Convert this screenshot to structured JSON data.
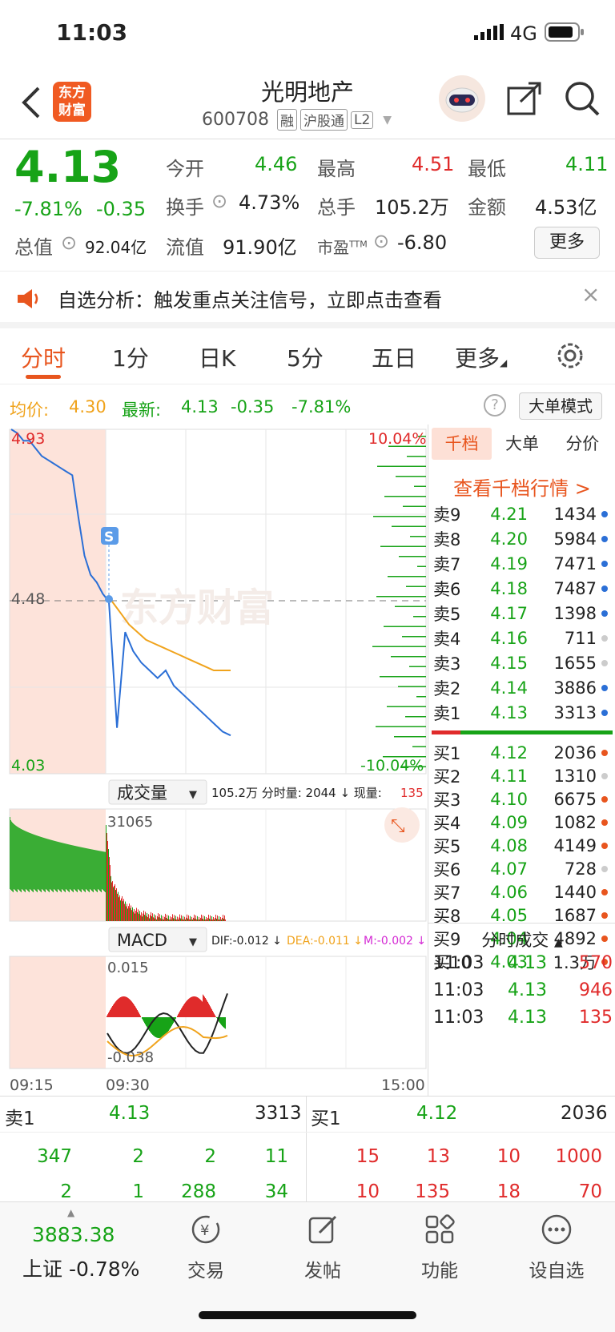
{
  "status": {
    "time": "11:03",
    "network": "4G"
  },
  "header": {
    "back_icon": "chevron-left-icon",
    "logo_text": [
      "东方",
      "财富"
    ],
    "stock_name": "光明地产",
    "stock_code": "600708",
    "tags": [
      "融",
      "沪股通",
      "L2"
    ]
  },
  "quote": {
    "price": "4.13",
    "change_pct": "-7.81%",
    "change": "-0.35",
    "open_label": "今开",
    "open": "4.46",
    "high_label": "最高",
    "high": "4.51",
    "low_label": "最低",
    "low": "4.11",
    "turnover_label": "换手",
    "turnover": "4.73%",
    "volume_label": "总手",
    "volume": "105.2万",
    "amount_label": "金额",
    "amount": "4.53亿",
    "total_value_label": "总值",
    "total_value": "92.04亿",
    "float_value_label": "流值",
    "float_value": "91.90亿",
    "pe_label": "市盈",
    "pe_sup": "TTM",
    "pe": "-6.80",
    "more_label": "更多"
  },
  "banner": {
    "text": "自选分析：触发重点关注信号，立即点击查看"
  },
  "tabs": [
    "分时",
    "1分",
    "日K",
    "5分",
    "五日",
    "更多"
  ],
  "avgline": {
    "avg_label": "均价:",
    "avg": "4.30",
    "latest_label": "最新:",
    "latest": "4.13",
    "change": "-0.35",
    "pct": "-7.81%",
    "mode_label": "大单模式"
  },
  "chart": {
    "price_high": "4.93",
    "price_mid": "4.48",
    "price_low": "4.03",
    "pct_high": "10.04%",
    "pct_low": "-10.04%",
    "signal_badge": "S",
    "watermark": "东方财富",
    "vol_selector": "成交量",
    "vol_info": "105.2万 分时量: 2044 ↓ 现量:",
    "vol_now": "135",
    "vol_max": "31065",
    "macd_selector": "MACD",
    "dif": "DIF:-0.012 ↓",
    "dea": "DEA:-0.011 ↓",
    "m": "M:-0.002 ↓",
    "macd_high": "0.015",
    "macd_low": "-0.038",
    "time_start": "09:15",
    "time_open": "09:30",
    "time_end": "15:00"
  },
  "chart_data": {
    "type": "line",
    "series": [
      {
        "values": [
          4.93,
          4.92,
          4.9,
          4.9,
          4.88,
          4.86,
          4.85,
          4.84,
          4.83,
          4.82,
          4.81,
          4.7,
          4.6,
          4.55,
          4.53,
          4.5,
          4.48,
          4.15,
          4.4,
          4.35,
          4.32,
          4.3,
          4.28,
          4.3,
          4.26,
          4.24,
          4.22,
          4.2,
          4.18,
          4.16,
          4.14,
          4.13
        ]
      },
      {
        "values": [
          4.48,
          4.45,
          4.42,
          4.4,
          4.38,
          4.37,
          4.36,
          4.35,
          4.34,
          4.33,
          4.32,
          4.31,
          4.3,
          4.3,
          4.3
        ]
      }
    ],
    "ylim": [
      4.03,
      4.93
    ]
  },
  "orderbook": {
    "tabs": [
      "千档",
      "大单",
      "分价"
    ],
    "link": "查看千档行情 >",
    "asks": [
      {
        "label": "卖9",
        "price": "4.21",
        "vol": "1434",
        "dot": "#2b6fd6"
      },
      {
        "label": "卖8",
        "price": "4.20",
        "vol": "5984",
        "dot": "#2b6fd6"
      },
      {
        "label": "卖7",
        "price": "4.19",
        "vol": "7471",
        "dot": "#2b6fd6"
      },
      {
        "label": "卖6",
        "price": "4.18",
        "vol": "7487",
        "dot": "#2b6fd6"
      },
      {
        "label": "卖5",
        "price": "4.17",
        "vol": "1398",
        "dot": "#2b6fd6"
      },
      {
        "label": "卖4",
        "price": "4.16",
        "vol": "711",
        "dot": "#cccccc"
      },
      {
        "label": "卖3",
        "price": "4.15",
        "vol": "1655",
        "dot": "#cccccc"
      },
      {
        "label": "卖2",
        "price": "4.14",
        "vol": "3886",
        "dot": "#2b6fd6"
      },
      {
        "label": "卖1",
        "price": "4.13",
        "vol": "3313",
        "dot": "#2b6fd6"
      }
    ],
    "bids": [
      {
        "label": "买1",
        "price": "4.12",
        "vol": "2036",
        "dot": "#e8551e"
      },
      {
        "label": "买2",
        "price": "4.11",
        "vol": "1310",
        "dot": "#cccccc"
      },
      {
        "label": "买3",
        "price": "4.10",
        "vol": "6675",
        "dot": "#e8551e"
      },
      {
        "label": "买4",
        "price": "4.09",
        "vol": "1082",
        "dot": "#e8551e"
      },
      {
        "label": "买5",
        "price": "4.08",
        "vol": "4149",
        "dot": "#e8551e"
      },
      {
        "label": "买6",
        "price": "4.07",
        "vol": "728",
        "dot": "#cccccc"
      },
      {
        "label": "买7",
        "price": "4.06",
        "vol": "1440",
        "dot": "#e8551e"
      },
      {
        "label": "买8",
        "price": "4.05",
        "vol": "1687",
        "dot": "#e8551e"
      },
      {
        "label": "买9",
        "price": "4.04",
        "vol": "4892",
        "dot": "#e8551e"
      },
      {
        "label": "买10",
        "price": "4.03",
        "vol": "1.3万",
        "dot": "#e8551e"
      }
    ],
    "fills_label": "分时成交",
    "fills": [
      {
        "time": "11:03",
        "price": "4.13",
        "vol": "570"
      },
      {
        "time": "11:03",
        "price": "4.13",
        "vol": "946"
      },
      {
        "time": "11:03",
        "price": "4.13",
        "vol": "135"
      }
    ]
  },
  "strip": {
    "sell_label": "卖1",
    "sell_price": "4.13",
    "sell_vol": "3313",
    "buy_label": "买1",
    "buy_price": "4.12",
    "buy_vol": "2036",
    "sell_rows": [
      [
        "347",
        "2",
        "2",
        "11"
      ],
      [
        "2",
        "1",
        "288",
        "34"
      ]
    ],
    "buy_rows": [
      [
        "15",
        "13",
        "10",
        "1000"
      ],
      [
        "10",
        "135",
        "18",
        "70"
      ]
    ]
  },
  "nav": {
    "index_value": "3883.38",
    "index_label": "上证 -0.78%",
    "items": [
      "交易",
      "发帖",
      "功能",
      "设自选"
    ]
  },
  "colors": {
    "accent": "#e8551e",
    "up": "#e02b2b",
    "down": "#17a317",
    "line": "#2b6fd6",
    "avg": "#f0a31c"
  }
}
